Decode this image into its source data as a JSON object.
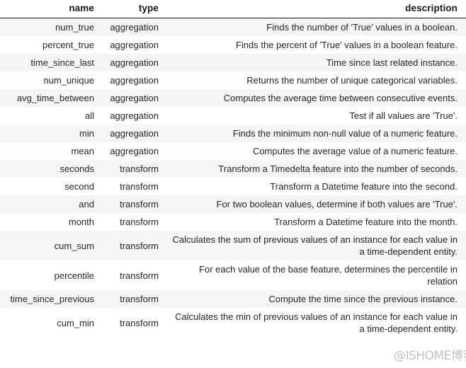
{
  "table": {
    "columns": [
      {
        "key": "name",
        "label": "name"
      },
      {
        "key": "type",
        "label": "type"
      },
      {
        "key": "description",
        "label": "description"
      }
    ],
    "rows": [
      {
        "name": "num_true",
        "type": "aggregation",
        "description": "Finds the number of 'True' values in a boolean."
      },
      {
        "name": "percent_true",
        "type": "aggregation",
        "description": "Finds the percent of 'True' values in a boolean feature."
      },
      {
        "name": "time_since_last",
        "type": "aggregation",
        "description": "Time since last related instance."
      },
      {
        "name": "num_unique",
        "type": "aggregation",
        "description": "Returns the number of unique categorical variables."
      },
      {
        "name": "avg_time_between",
        "type": "aggregation",
        "description": "Computes the average time between consecutive events."
      },
      {
        "name": "all",
        "type": "aggregation",
        "description": "Test if all values are 'True'."
      },
      {
        "name": "min",
        "type": "aggregation",
        "description": "Finds the minimum non-null value of a numeric feature."
      },
      {
        "name": "mean",
        "type": "aggregation",
        "description": "Computes the average value of a numeric feature."
      },
      {
        "name": "seconds",
        "type": "transform",
        "description": "Transform a Timedelta feature into the number of seconds."
      },
      {
        "name": "second",
        "type": "transform",
        "description": "Transform a Datetime feature into the second."
      },
      {
        "name": "and",
        "type": "transform",
        "description": "For two boolean values, determine if both values are 'True'."
      },
      {
        "name": "month",
        "type": "transform",
        "description": "Transform a Datetime feature into the month."
      },
      {
        "name": "cum_sum",
        "type": "transform",
        "description": "Calculates the sum of previous values of an instance for each value in a time-dependent entity."
      },
      {
        "name": "percentile",
        "type": "transform",
        "description": "For each value of the base feature, determines the percentile in relation"
      },
      {
        "name": "time_since_previous",
        "type": "transform",
        "description": "Compute the time since the previous instance."
      },
      {
        "name": "cum_min",
        "type": "transform",
        "description": "Calculates the min of previous values of an instance for each value in a time-dependent entity."
      }
    ]
  },
  "watermark": {
    "text": "@ISHOME博客"
  },
  "colors": {
    "row_stripe": "#f5f5f5",
    "row_plain": "#ffffff",
    "text": "#262626",
    "header_rule": "#111111"
  }
}
